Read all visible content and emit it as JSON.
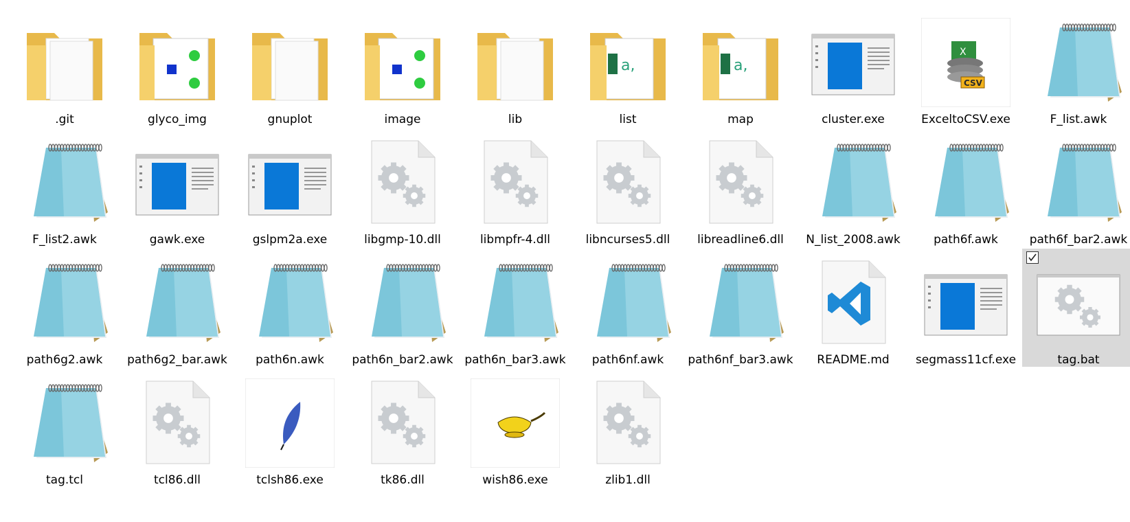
{
  "files": [
    {
      "name": ".git",
      "icon": "folder-icon",
      "interactable": true
    },
    {
      "name": "glyco_img",
      "icon": "folder-image-icon",
      "interactable": true
    },
    {
      "name": "gnuplot",
      "icon": "folder-icon",
      "interactable": true
    },
    {
      "name": "image",
      "icon": "folder-image-icon",
      "interactable": true
    },
    {
      "name": "lib",
      "icon": "folder-icon",
      "interactable": true
    },
    {
      "name": "list",
      "icon": "folder-excel-icon",
      "interactable": true
    },
    {
      "name": "map",
      "icon": "folder-excel-icon",
      "interactable": true
    },
    {
      "name": "cluster.exe",
      "icon": "exe-window-icon",
      "interactable": true
    },
    {
      "name": "ExceltoCSV.exe",
      "icon": "excel-csv-app-icon",
      "interactable": true
    },
    {
      "name": "F_list.awk",
      "icon": "notepad-icon",
      "interactable": true
    },
    {
      "name": "F_list2.awk",
      "icon": "notepad-icon",
      "interactable": true
    },
    {
      "name": "gawk.exe",
      "icon": "exe-window-icon",
      "interactable": true
    },
    {
      "name": "gslpm2a.exe",
      "icon": "exe-window-icon",
      "interactable": true
    },
    {
      "name": "libgmp-10.dll",
      "icon": "gear-document-icon",
      "interactable": true
    },
    {
      "name": "libmpfr-4.dll",
      "icon": "gear-document-icon",
      "interactable": true
    },
    {
      "name": "libncurses5.dll",
      "icon": "gear-document-icon",
      "interactable": true
    },
    {
      "name": "libreadline6.dll",
      "icon": "gear-document-icon",
      "interactable": true
    },
    {
      "name": "N_list_2008.awk",
      "icon": "notepad-icon",
      "interactable": true
    },
    {
      "name": "path6f.awk",
      "icon": "notepad-icon",
      "interactable": true
    },
    {
      "name": "path6f_bar2.awk",
      "icon": "notepad-icon",
      "interactable": true
    },
    {
      "name": "path6g2.awk",
      "icon": "notepad-icon",
      "interactable": true
    },
    {
      "name": "path6g2_bar.awk",
      "icon": "notepad-icon",
      "interactable": true
    },
    {
      "name": "path6n.awk",
      "icon": "notepad-icon",
      "interactable": true
    },
    {
      "name": "path6n_bar2.awk",
      "icon": "notepad-icon",
      "interactable": true
    },
    {
      "name": "path6n_bar3.awk",
      "icon": "notepad-icon",
      "interactable": true
    },
    {
      "name": "path6nf.awk",
      "icon": "notepad-icon",
      "interactable": true
    },
    {
      "name": "path6nf_bar3.awk",
      "icon": "notepad-icon",
      "interactable": true
    },
    {
      "name": "README.md",
      "icon": "vscode-document-icon",
      "interactable": true
    },
    {
      "name": "segmass11cf.exe",
      "icon": "exe-window-icon",
      "interactable": true
    },
    {
      "name": "tag.bat",
      "icon": "gear-window-icon",
      "interactable": true,
      "selected": true
    },
    {
      "name": "tag.tcl",
      "icon": "notepad-icon",
      "interactable": true
    },
    {
      "name": "tcl86.dll",
      "icon": "gear-document-icon",
      "interactable": true
    },
    {
      "name": "tclsh86.exe",
      "icon": "feather-app-icon",
      "interactable": true
    },
    {
      "name": "tk86.dll",
      "icon": "gear-document-icon",
      "interactable": true
    },
    {
      "name": "wish86.exe",
      "icon": "lamp-app-icon",
      "interactable": true
    },
    {
      "name": "zlib1.dll",
      "icon": "gear-document-icon",
      "interactable": true
    }
  ],
  "colors": {
    "folder": "#f5d06b",
    "folder_dark": "#e8b94a",
    "exe_blue": "#0a78d7",
    "notepad": "#7cc6da",
    "selection": "#d9d9d9",
    "gear": "#c8ccd0",
    "vscode": "#1e8ad6"
  }
}
